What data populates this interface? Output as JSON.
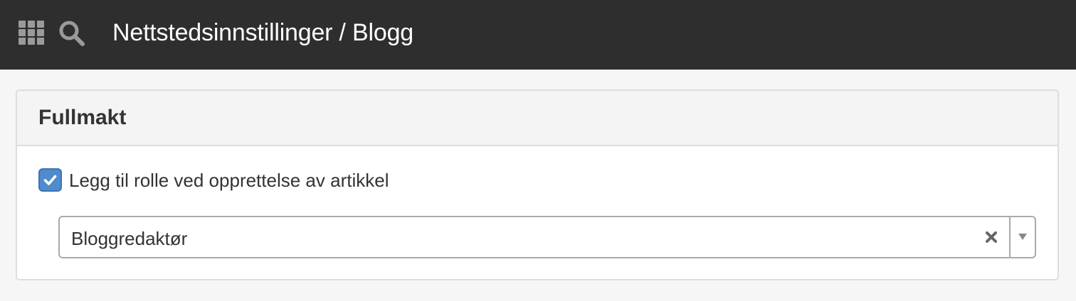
{
  "header": {
    "apps_icon": "grid-icon",
    "search_icon": "search-icon",
    "title": "Nettstedsinnstillinger / Blogg",
    "background": "#2e2e2e"
  },
  "panel": {
    "title": "Fullmakt",
    "checkbox": {
      "label": "Legg til rolle ved opprettelse av artikkel",
      "checked": true,
      "color": "#4f8ccd"
    },
    "role_select": {
      "value": "Bloggredaktør",
      "clear_icon": "clear-x-icon",
      "dropdown_icon": "triangle-down-icon"
    }
  }
}
